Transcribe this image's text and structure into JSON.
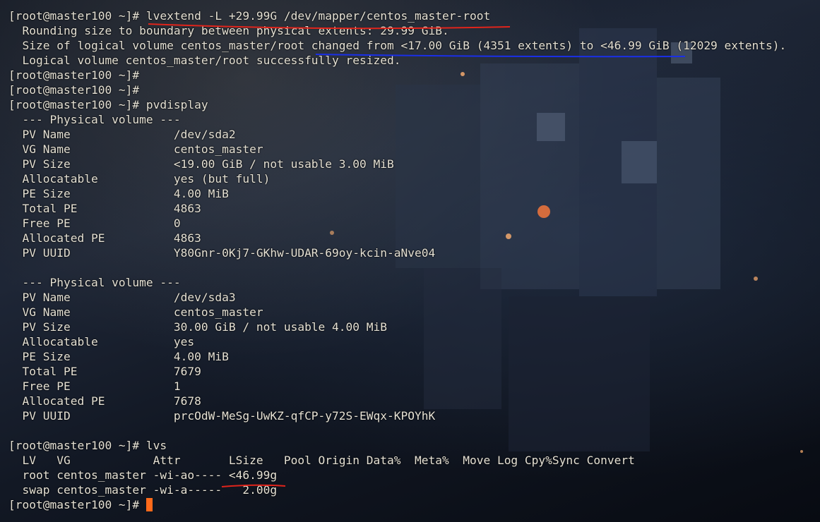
{
  "terminal": {
    "lines": [
      "[root@master100 ~]# lvextend -L +29.99G /dev/mapper/centos_master-root",
      "  Rounding size to boundary between physical extents: 29.99 GiB.",
      "  Size of logical volume centos_master/root changed from <17.00 GiB (4351 extents) to <46.99 GiB (12029 extents).",
      "  Logical volume centos_master/root successfully resized.",
      "[root@master100 ~]#",
      "[root@master100 ~]#",
      "[root@master100 ~]# pvdisplay",
      "  --- Physical volume ---",
      "  PV Name               /dev/sda2",
      "  VG Name               centos_master",
      "  PV Size               <19.00 GiB / not usable 3.00 MiB",
      "  Allocatable           yes (but full)",
      "  PE Size               4.00 MiB",
      "  Total PE              4863",
      "  Free PE               0",
      "  Allocated PE          4863",
      "  PV UUID               Y80Gnr-0Kj7-GKhw-UDAR-69oy-kcin-aNve04",
      "",
      "  --- Physical volume ---",
      "  PV Name               /dev/sda3",
      "  VG Name               centos_master",
      "  PV Size               30.00 GiB / not usable 4.00 MiB",
      "  Allocatable           yes",
      "  PE Size               4.00 MiB",
      "  Total PE              7679",
      "  Free PE               1",
      "  Allocated PE          7678",
      "  PV UUID               prcOdW-MeSg-UwKZ-qfCP-y72S-EWqx-KPOYhK",
      "",
      "[root@master100 ~]# lvs",
      "  LV   VG            Attr       LSize   Pool Origin Data%  Meta%  Move Log Cpy%Sync Convert",
      "  root centos_master -wi-ao---- <46.99g",
      "  swap centos_master -wi-a-----   2.00g"
    ],
    "prompt": "[root@master100 ~]# "
  },
  "colors": {
    "text": "#e6e2d6",
    "cursor": "#ff6a1a",
    "red_underline": "#e0241b",
    "blue_underline": "#1a2fe8"
  }
}
